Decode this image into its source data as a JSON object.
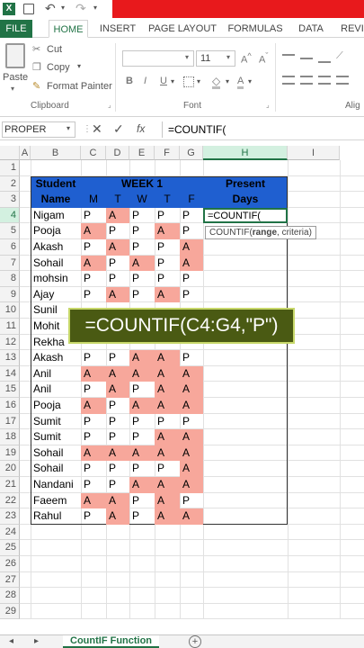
{
  "qat": {
    "save_icon": "save-icon",
    "undo_icon": "undo-icon",
    "redo_icon": "redo-icon",
    "accent": "#e8191c"
  },
  "tabs": [
    "FILE",
    "HOME",
    "INSERT",
    "PAGE LAYOUT",
    "FORMULAS",
    "DATA",
    "REVI"
  ],
  "ribbon": {
    "paste": "Paste",
    "cut": "Cut",
    "copy": "Copy",
    "format_painter": "Format Painter",
    "clipboard": "Clipboard",
    "font_size": "11",
    "font": "Font",
    "bold": "B",
    "italic": "I",
    "underline": "U",
    "font_color": "A",
    "alig": "Alig"
  },
  "formula_bar": {
    "name_box": "PROPER",
    "fx": "fx",
    "formula": "=COUNTIF("
  },
  "columns": [
    "A",
    "B",
    "C",
    "D",
    "E",
    "F",
    "G",
    "H",
    "I"
  ],
  "rows": [
    "1",
    "2",
    "3",
    "4",
    "5",
    "6",
    "7",
    "8",
    "9",
    "10",
    "11",
    "12",
    "13",
    "14",
    "15",
    "16",
    "17",
    "18",
    "19",
    "20",
    "21",
    "22",
    "23",
    "24",
    "25",
    "26",
    "27",
    "28",
    "29"
  ],
  "table": {
    "student": "Student",
    "name": "Name",
    "week": "WEEK 1",
    "days": [
      "M",
      "T",
      "W",
      "T",
      "F"
    ],
    "present": "Present",
    "present_days": "Days",
    "rows": [
      {
        "name": "Nigam",
        "att": [
          "P",
          "A",
          "P",
          "P",
          "P"
        ]
      },
      {
        "name": "Pooja",
        "att": [
          "A",
          "P",
          "P",
          "A",
          "P"
        ]
      },
      {
        "name": "Akash",
        "att": [
          "P",
          "A",
          "P",
          "P",
          "A"
        ]
      },
      {
        "name": "Sohail",
        "att": [
          "A",
          "P",
          "A",
          "P",
          "A"
        ]
      },
      {
        "name": "mohsin",
        "att": [
          "P",
          "P",
          "P",
          "P",
          "P"
        ]
      },
      {
        "name": "Ajay",
        "att": [
          "P",
          "A",
          "P",
          "A",
          "P"
        ]
      },
      {
        "name": "Sunil",
        "att": [
          "",
          "",
          "",
          "",
          ""
        ]
      },
      {
        "name": "Mohit",
        "att": [
          "",
          "",
          "",
          "",
          ""
        ]
      },
      {
        "name": "Rekha",
        "att": [
          "",
          "",
          "",
          "",
          ""
        ]
      },
      {
        "name": "Akash",
        "att": [
          "P",
          "P",
          "A",
          "A",
          "P"
        ]
      },
      {
        "name": "Anil",
        "att": [
          "A",
          "A",
          "A",
          "A",
          "A"
        ]
      },
      {
        "name": "Anil",
        "att": [
          "P",
          "A",
          "P",
          "A",
          "A"
        ]
      },
      {
        "name": "Pooja",
        "att": [
          "A",
          "P",
          "A",
          "A",
          "A"
        ]
      },
      {
        "name": "Sumit",
        "att": [
          "P",
          "P",
          "P",
          "P",
          "P"
        ]
      },
      {
        "name": "Sumit",
        "att": [
          "P",
          "P",
          "P",
          "A",
          "A"
        ]
      },
      {
        "name": "Sohail",
        "att": [
          "A",
          "A",
          "A",
          "A",
          "A"
        ]
      },
      {
        "name": "Sohail",
        "att": [
          "P",
          "P",
          "P",
          "P",
          "A"
        ]
      },
      {
        "name": "Nandani",
        "att": [
          "P",
          "P",
          "A",
          "A",
          "A"
        ]
      },
      {
        "name": "Faeem",
        "att": [
          "A",
          "A",
          "P",
          "A",
          "P"
        ]
      },
      {
        "name": "Rahul",
        "att": [
          "P",
          "A",
          "P",
          "A",
          "A"
        ]
      }
    ],
    "active_cell_text": "=COUNTIF(",
    "tooltip_fn": "COUNTIF(",
    "tooltip_arg1": "range",
    "tooltip_rest": ", criteria)"
  },
  "banner": "=COUNTIF(C4:G4,\"P\")",
  "sheet_tab": "CountIF Function",
  "colors": {
    "header_blue": "#1f5fd0",
    "absent_red": "#f7a79b",
    "excel_green": "#217346"
  }
}
